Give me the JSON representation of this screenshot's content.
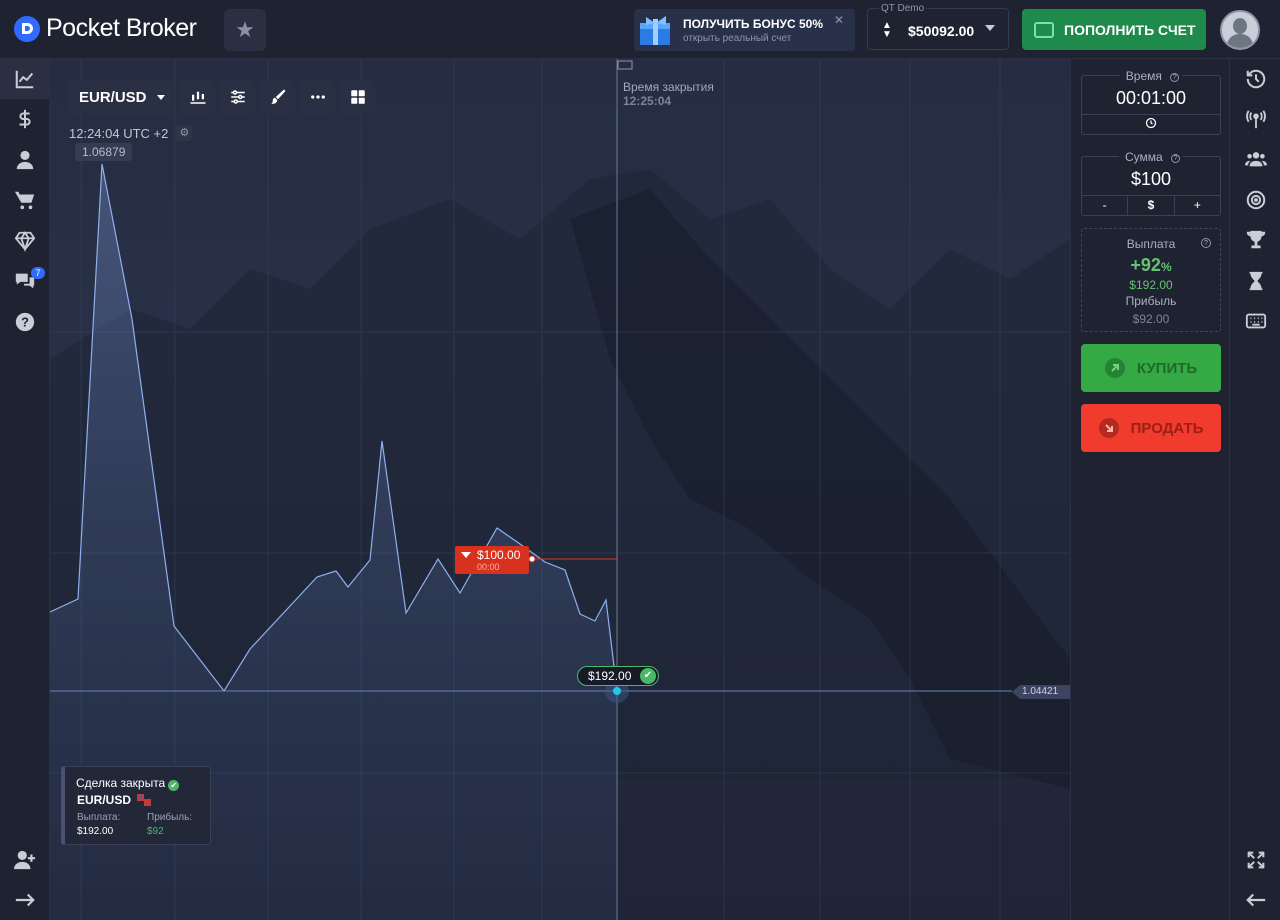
{
  "header": {
    "logo_text": "Pocket Broker",
    "bonus_title": "ПОЛУЧИТЬ БОНУС 50%",
    "bonus_subtitle": "открыть реальный счет",
    "account_label": "QT Demo",
    "balance": "$50092.00",
    "deposit_label": "ПОПОЛНИТЬ СЧЕТ"
  },
  "left_nav": {
    "items": [
      {
        "icon": "chart-line-icon",
        "active": true
      },
      {
        "icon": "dollar-icon"
      },
      {
        "icon": "user-icon"
      },
      {
        "icon": "cart-icon"
      },
      {
        "icon": "diamond-icon"
      },
      {
        "icon": "chat-icon",
        "badge": "7"
      },
      {
        "icon": "help-icon"
      }
    ],
    "bottom": [
      "add-user-icon",
      "arrow-right-icon"
    ]
  },
  "chart": {
    "symbol": "EUR/USD",
    "clock": "12:24:04 UTC +2",
    "high_label": "1.06879",
    "close_title": "Время закрытия",
    "close_value": "12:25:04",
    "current_price": "1.04421",
    "trade_amount": "$100.00",
    "trade_timer": "00:00",
    "win_amount": "$192.00"
  },
  "deal_card": {
    "title": "Сделка закрыта",
    "pair": "EUR/USD",
    "payout_label": "Выплата:",
    "profit_label": "Прибыль:",
    "payout_value": "$192.00",
    "profit_value": "$92"
  },
  "panel": {
    "time_label": "Время",
    "time_value": "00:01:00",
    "amount_label": "Сумма",
    "amount_value": "$100",
    "minus": "-",
    "currency": "$",
    "plus": "+",
    "payout_label": "Выплата",
    "payout_pct": "+92",
    "pct_sign": "%",
    "payout_value": "$192.00",
    "profit_label": "Прибыль",
    "profit_value": "$92.00",
    "buy_label": "КУПИТЬ",
    "sell_label": "ПРОДАТЬ"
  },
  "colors": {
    "buy": "#35a944",
    "sell": "#f13b2d",
    "deposit": "#1e8a4b",
    "accent": "#2f6bff"
  }
}
